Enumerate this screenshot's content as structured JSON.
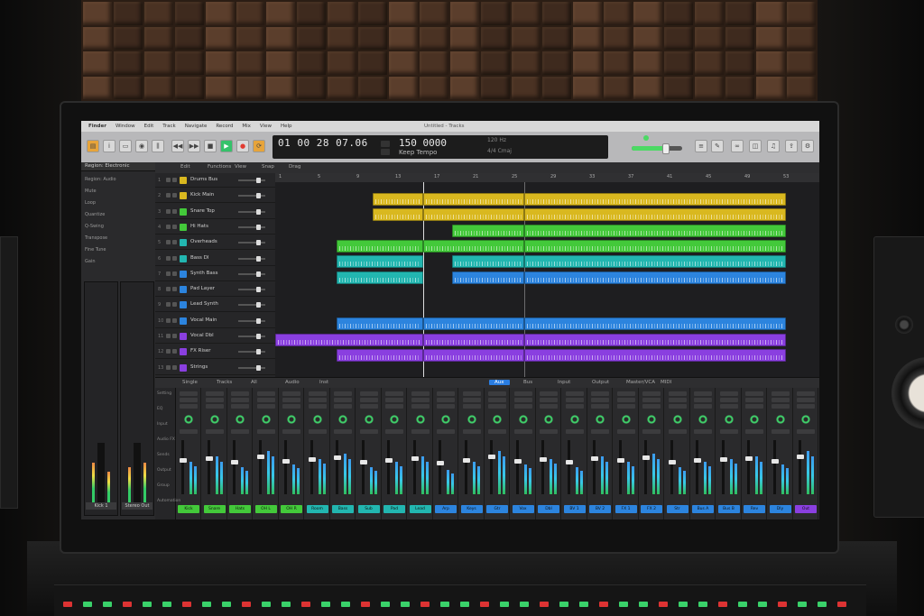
{
  "menubar": {
    "items": [
      "Finder",
      "Window",
      "Edit",
      "Track",
      "Navigate",
      "Record",
      "Mix",
      "View",
      "Help"
    ],
    "window_title": "Untitled - Tracks"
  },
  "transport": {
    "position": "01 00 28 07.06",
    "tempo": "150 0000",
    "tempo_label": "Keep Tempo",
    "lcd_aux_top": "120 Hz",
    "lcd_aux_bottom": "4/4  Cmaj"
  },
  "inspector": {
    "header": "Region: Electronic",
    "rows": [
      "Region: Audio",
      "Mute",
      "Loop",
      "Quantize",
      "Q-Swing",
      "Transpose",
      "Fine Tune",
      "Gain"
    ],
    "channel_left": "Kick 1",
    "channel_right": "Stereo Out"
  },
  "toolbar": {
    "items": [
      "Edit",
      "Functions",
      "View",
      "Snap",
      "Drag"
    ]
  },
  "tracks": [
    {
      "num": "1",
      "name": "Drums Bus"
    },
    {
      "num": "2",
      "name": "Kick Main"
    },
    {
      "num": "3",
      "name": "Snare Top"
    },
    {
      "num": "4",
      "name": "Hi Hats"
    },
    {
      "num": "5",
      "name": "Overheads"
    },
    {
      "num": "6",
      "name": "Bass DI"
    },
    {
      "num": "7",
      "name": "Synth Bass"
    },
    {
      "num": "8",
      "name": "Pad Layer"
    },
    {
      "num": "9",
      "name": "Lead Synth"
    },
    {
      "num": "10",
      "name": "Vocal Main"
    },
    {
      "num": "11",
      "name": "Vocal Dbl"
    },
    {
      "num": "12",
      "name": "FX Riser"
    },
    {
      "num": "13",
      "name": "Strings"
    }
  ],
  "ruler": [
    "1",
    "5",
    "9",
    "13",
    "17",
    "21",
    "25",
    "29",
    "33",
    "37",
    "41",
    "45",
    "49",
    "53"
  ],
  "colors": {
    "yellow": "#d9b81f",
    "green": "#43c93a",
    "teal": "#22b6b0",
    "blue": "#2c84de",
    "purple": "#8a3fe0",
    "accent": "#2a7de1"
  },
  "mixer": {
    "tabs": [
      "Single",
      "Tracks",
      "All",
      "Audio",
      "Inst",
      "Aux",
      "Bus",
      "Input",
      "Output",
      "Master/VCA",
      "MIDI"
    ],
    "row_labels": [
      "Setting",
      "EQ",
      "Input",
      "Audio FX",
      "Sends",
      "Output",
      "Group",
      "Automation"
    ],
    "channels": [
      {
        "label": "Kick",
        "color": "#43c93a"
      },
      {
        "label": "Snare",
        "color": "#43c93a"
      },
      {
        "label": "Hats",
        "color": "#43c93a"
      },
      {
        "label": "OH L",
        "color": "#43c93a"
      },
      {
        "label": "OH R",
        "color": "#43c93a"
      },
      {
        "label": "Room",
        "color": "#22b6b0"
      },
      {
        "label": "Bass",
        "color": "#22b6b0"
      },
      {
        "label": "Sub",
        "color": "#22b6b0"
      },
      {
        "label": "Pad",
        "color": "#22b6b0"
      },
      {
        "label": "Lead",
        "color": "#22b6b0"
      },
      {
        "label": "Arp",
        "color": "#2c84de"
      },
      {
        "label": "Keys",
        "color": "#2c84de"
      },
      {
        "label": "Gtr",
        "color": "#2c84de"
      },
      {
        "label": "Vox",
        "color": "#2c84de"
      },
      {
        "label": "Dbl",
        "color": "#2c84de"
      },
      {
        "label": "BV 1",
        "color": "#2c84de"
      },
      {
        "label": "BV 2",
        "color": "#2c84de"
      },
      {
        "label": "FX 1",
        "color": "#2c84de"
      },
      {
        "label": "FX 2",
        "color": "#2c84de"
      },
      {
        "label": "Str",
        "color": "#2c84de"
      },
      {
        "label": "Bus A",
        "color": "#2c84de"
      },
      {
        "label": "Bus B",
        "color": "#2c84de"
      },
      {
        "label": "Rev",
        "color": "#2c84de"
      },
      {
        "label": "Dly",
        "color": "#2c84de"
      },
      {
        "label": "Out",
        "color": "#8a3fe0"
      }
    ]
  }
}
